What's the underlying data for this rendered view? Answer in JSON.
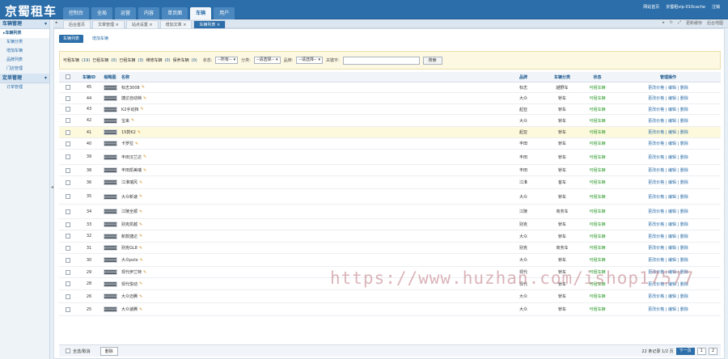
{
  "brand": "京蜀租车",
  "topnav": [
    "控制台",
    "全局",
    "运营",
    "内容",
    "单页面",
    "车辆",
    "用户"
  ],
  "topnav_active_index": 5,
  "toplinks": [
    "网站首页",
    "京蜀租vip-010cache",
    "注销"
  ],
  "sidebar": {
    "groups": [
      {
        "title": "车辆管理",
        "items": [
          "车辆列表",
          "车辆分类",
          "增加车辆",
          "品牌列表",
          "门店管理"
        ]
      },
      {
        "title": "定单管理",
        "items": [
          "订单管理"
        ]
      }
    ]
  },
  "tabs": [
    "后台首页",
    "文章管理",
    "站点设置",
    "增加文章",
    "车辆列表"
  ],
  "tab_tools": [
    "更新缓存",
    "后台地图"
  ],
  "subtabs": [
    "车辆列表",
    "增加车辆"
  ],
  "filter": {
    "counts": [
      {
        "label": "可租车辆",
        "n": "(19)"
      },
      {
        "label": "已租车辆",
        "n": "(0)"
      },
      {
        "label": "已租车辆",
        "n": "(3)"
      },
      {
        "label": "维修车辆",
        "n": "(0)"
      },
      {
        "label": "保养车辆",
        "n": "(0)"
      }
    ],
    "status_label": "状态:",
    "status_value": "--所有--",
    "category_label": "分类:",
    "category_value": "--请选择--",
    "brand_label": "品牌:",
    "brand_value": "--请选择--",
    "keyword_label": "关键字:",
    "search_button": "搜索"
  },
  "columns": {
    "id": "车辆ID",
    "img": "缩略图",
    "name": "名称",
    "brand": "品牌",
    "type": "车辆分类",
    "status": "状态",
    "op": "管理操作"
  },
  "rows": [
    {
      "id": "45",
      "name": "标志3008",
      "brand": "标志",
      "type": "越野车",
      "status": "可租车辆"
    },
    {
      "id": "44",
      "name": "捷达自动档",
      "brand": "大众",
      "type": "轿车",
      "status": "可租车辆"
    },
    {
      "id": "43",
      "name": "K2手动挡",
      "brand": "起亚",
      "type": "轿车",
      "status": "可租车辆"
    },
    {
      "id": "42",
      "name": "宝来",
      "brand": "大众",
      "type": "轿车",
      "status": "可租车辆"
    },
    {
      "id": "41",
      "name": "15款K2",
      "brand": "起亚",
      "type": "轿车",
      "status": "可租车辆"
    },
    {
      "id": "40",
      "name": "卡罗拉",
      "brand": "丰田",
      "type": "轿车",
      "status": "可租车辆"
    },
    {
      "id": "39",
      "name": "丰田汉兰达",
      "brand": "丰田",
      "type": "轿车",
      "status": "可租车辆"
    },
    {
      "id": "38",
      "name": "丰田凯美瑞",
      "brand": "丰田",
      "type": "轿车",
      "status": "可租车辆"
    },
    {
      "id": "36",
      "name": "江淮瑞风",
      "brand": "江淮",
      "type": "客车",
      "status": "可租车辆"
    },
    {
      "id": "35",
      "name": "大众新速",
      "brand": "大众",
      "type": "轿车",
      "status": "可租车辆"
    },
    {
      "id": "34",
      "name": "江陵全顺",
      "brand": "江陵",
      "type": "商务车",
      "status": "可租车辆"
    },
    {
      "id": "33",
      "name": "别克凯越",
      "brand": "别克",
      "type": "轿车",
      "status": "可租车辆"
    },
    {
      "id": "32",
      "name": "新款捷达",
      "brand": "大众",
      "type": "轿车",
      "status": "可租车辆"
    },
    {
      "id": "31",
      "name": "别克GL8",
      "brand": "别克",
      "type": "商务车",
      "status": "可租车辆"
    },
    {
      "id": "30",
      "name": "大众polo",
      "brand": "大众",
      "type": "轿车",
      "status": "可租车辆"
    },
    {
      "id": "29",
      "name": "现代伊兰特",
      "brand": "现代",
      "type": "轿车",
      "status": "可租车辆"
    },
    {
      "id": "28",
      "name": "现代悦动",
      "brand": "现代",
      "type": "轿车",
      "status": "可租车辆"
    },
    {
      "id": "26",
      "name": "大众迈腾",
      "brand": "大众",
      "type": "轿车",
      "status": "可租车辆"
    },
    {
      "id": "25",
      "name": "大众速腾",
      "brand": "大众",
      "type": "轿车",
      "status": "可租车辆"
    }
  ],
  "row_ops": {
    "price": "更改价格",
    "edit": "编辑",
    "delete": "删除",
    "sep": " | "
  },
  "footer": {
    "select_all": "全选/取消",
    "delete": "删除",
    "total": "22 条记录 1/2 页",
    "next": "下一页",
    "pages": [
      "1",
      "2"
    ]
  },
  "watermark": "https://www.huzhan.com/ishop17577",
  "colors": {
    "header": "#2c6ea9",
    "status_green": "#2e9a2e",
    "highlight_row": "#fdf9dc"
  }
}
